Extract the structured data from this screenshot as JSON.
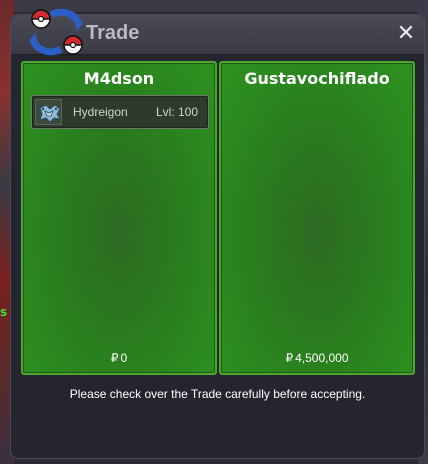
{
  "window": {
    "title": "Trade",
    "close_label": "✕"
  },
  "background": {
    "edge_text": "s"
  },
  "left_panel": {
    "player_name": "M4dson",
    "items": [
      {
        "name": "Hydreigon",
        "level": "Lvl: 100",
        "icon": "hydreigon-icon"
      }
    ],
    "money_symbol": "₽",
    "money": "0"
  },
  "right_panel": {
    "player_name": "Gustavochiflado",
    "items": [],
    "money_symbol": "₽",
    "money": "4,500,000"
  },
  "notice": "Please check over the Trade carefully before accepting.",
  "colors": {
    "panel_border": "#4aa82e",
    "panel_bg": "#2b8a1f",
    "window_bg": "#25252f",
    "title_text": "#b8b8c6"
  }
}
